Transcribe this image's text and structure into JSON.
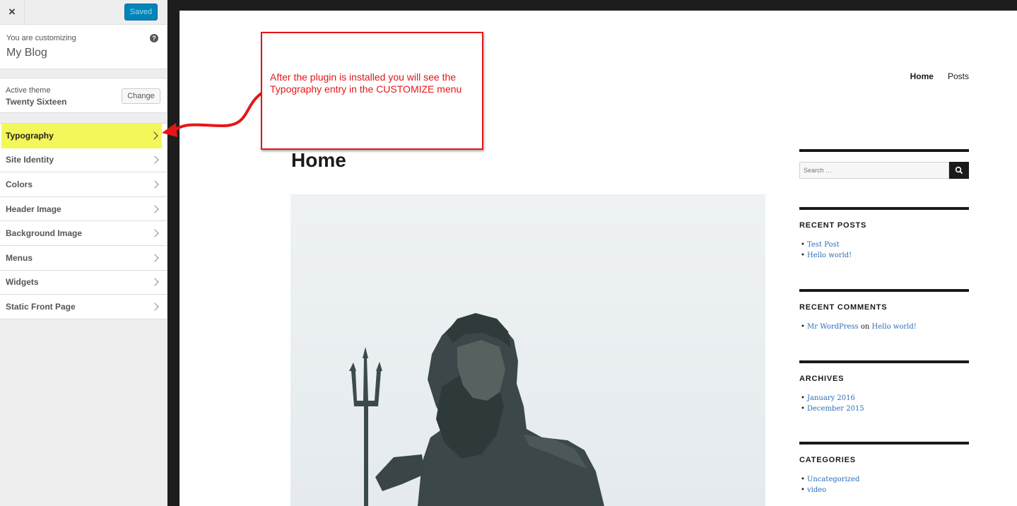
{
  "customizer": {
    "close_icon": "×",
    "save_label": "Saved",
    "customizing_label": "You are customizing",
    "site_title": "My Blog",
    "help_icon": "?",
    "theme_label": "Active theme",
    "theme_name": "Twenty Sixteen",
    "change_label": "Change",
    "panels": [
      {
        "label": "Typography"
      },
      {
        "label": "Site Identity"
      },
      {
        "label": "Colors"
      },
      {
        "label": "Header Image"
      },
      {
        "label": "Background Image"
      },
      {
        "label": "Menus"
      },
      {
        "label": "Widgets"
      },
      {
        "label": "Static Front Page"
      }
    ],
    "highlight_color": "#f4f759",
    "save_color": "#0085ba"
  },
  "annotation": {
    "text": "After the plugin is installed you will see the Typography entry in the CUSTOMIZE menu",
    "color": "#e51616"
  },
  "preview": {
    "nav": [
      "Home",
      "Posts"
    ],
    "page_title": "Home",
    "featured_image": "statue-with-trident",
    "search_placeholder": "Search …",
    "widgets": {
      "recent_posts": {
        "title": "RECENT POSTS",
        "items": [
          "Test Post",
          "Hello world!"
        ]
      },
      "recent_comments": {
        "title": "RECENT COMMENTS",
        "author": "Mr WordPress",
        "connector": "on",
        "post": "Hello world!"
      },
      "archives": {
        "title": "ARCHIVES",
        "items": [
          "January 2016",
          "December 2015"
        ]
      },
      "categories": {
        "title": "CATEGORIES",
        "items": [
          "Uncategorized",
          "video"
        ]
      }
    },
    "link_color": "#2a6fb5"
  }
}
